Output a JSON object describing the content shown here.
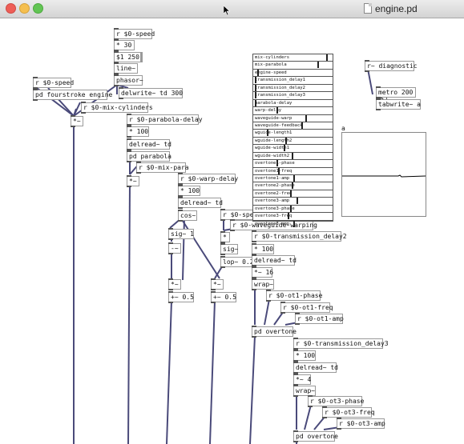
{
  "window": {
    "title": "engine.pd"
  },
  "objects": {
    "r_speed_top": "r $0-speed",
    "n30": "* 30",
    "msg_line": "$1 250",
    "line": "line~",
    "phasor": "phasor~",
    "r_speed_left": "r $0-speed",
    "pd_fourstroke": "pd fourstroke engine",
    "delwrite": "delwrite~ td 300",
    "r_mix_cyl": "r $0-mix-cylinders",
    "mul_left": "*~",
    "r_parabola_delay": "r $0-parabola-delay",
    "m100_a": "* 100",
    "delread_a": "delread~ td",
    "pd_parabola": "pd parabola",
    "r_mix_para": "r $0-mix-para",
    "mul_para": "*~",
    "r_warp_delay": "r $0-warp-delay",
    "m100_b": "* 100",
    "delread_b": "delread~ td",
    "cos": "cos~",
    "r_speed_mid": "r $0-speed",
    "r_waveguide": "r $0-waveguide-warping",
    "sig_a": "sig~ 1",
    "mul_sm": "*",
    "sig_b": "sig~",
    "minus": "-~",
    "lop": "lop~ 0.2",
    "mul_a": "*~",
    "plus_a": "+~ 0.5",
    "mul_b": "*~",
    "plus_b": "+~ 0.5",
    "r_trans2": "r $0-transmission_delay2",
    "m100_c": "* 100",
    "delread_c": "delread~ td",
    "mul16": "*~ 16",
    "wrap_a": "wrap~",
    "r_ot1_phase": "r $0-ot1-phase",
    "r_ot1_freq": "r $0-ot1-freq",
    "r_ot1_amp": "r $0-ot1-amp",
    "pd_overtone_a": "pd overtone",
    "r_trans3": "r $0-transmission_delay3",
    "m100_d": "* 100",
    "delread_d": "delread~ td",
    "mul4": "*~ 4",
    "wrap_b": "wrap~",
    "r_ot3_phase": "r $0-ot3-phase",
    "r_ot3_freq": "r $0-ot3-freq",
    "r_ot3_amp": "r $0-ot3-amp",
    "pd_overtone_b": "pd overtone",
    "r_diagnostic": "r~ diagnostic",
    "metro": "metro 200",
    "tabwrite": "tabwrite~ a"
  },
  "array": {
    "label": "a"
  },
  "sliders": [
    {
      "label": "mix-cylinders",
      "value": 0.95
    },
    {
      "label": "mix-parabola",
      "value": 0.83
    },
    {
      "label": "engine-speed",
      "value": 0.05
    },
    {
      "label": "transmission_delay1",
      "value": 0.02
    },
    {
      "label": "transmission_delay2",
      "value": 0.02
    },
    {
      "label": "transmission_delay3",
      "value": 0.02
    },
    {
      "label": "parabola-delay",
      "value": 0.02
    },
    {
      "label": "warp-delay",
      "value": 0.3
    },
    {
      "label": "waveguide-warp",
      "value": 0.68
    },
    {
      "label": "waveguide-feedback",
      "value": 0.62
    },
    {
      "label": "wguide-length1",
      "value": 0.18
    },
    {
      "label": "wguide-length2",
      "value": 0.42
    },
    {
      "label": "wguide-width1",
      "value": 0.4
    },
    {
      "label": "wguide-width2",
      "value": 0.5
    },
    {
      "label": "overtone1-phase",
      "value": 0.3
    },
    {
      "label": "overtone1-freq",
      "value": 0.32
    },
    {
      "label": "overtone1-amp",
      "value": 0.52
    },
    {
      "label": "overtone2-phase",
      "value": 0.5
    },
    {
      "label": "overtone2-freq",
      "value": 0.48
    },
    {
      "label": "overtone3-amp",
      "value": 0.56
    },
    {
      "label": "overtone3-phase",
      "value": 0.48
    },
    {
      "label": "overtone3-freq",
      "value": 0.45
    },
    {
      "label": "overtone3-amp",
      "value": 0.52
    }
  ]
}
